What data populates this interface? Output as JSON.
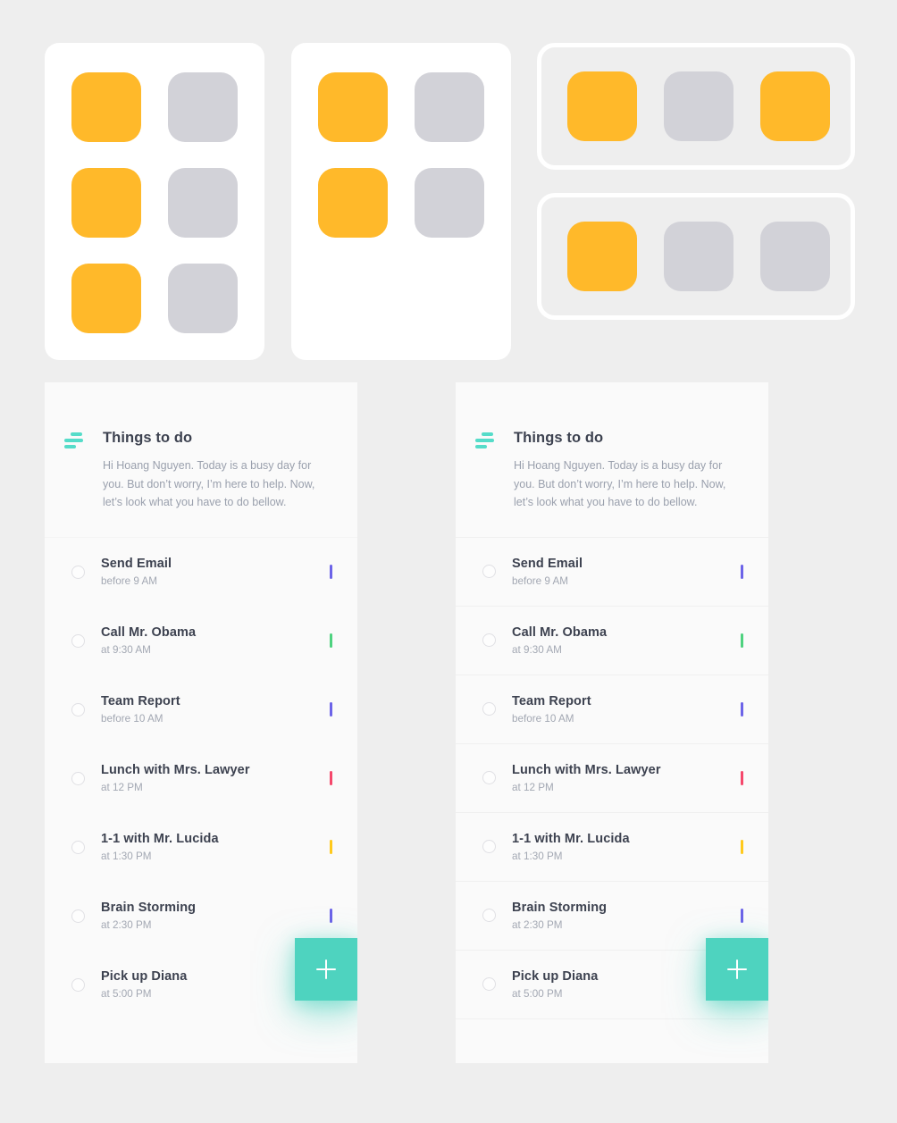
{
  "page": {
    "background_color": "#EEEEEE",
    "card_color": "#FFFFFF",
    "panel_color": "#FAFAFA",
    "accent_color": "#4ED3BF",
    "orange_tile_color": "#FFB92A",
    "grey_tile_color": "#D2D2D8"
  },
  "grid_cards": [
    {
      "name": "grid-card-three-rows",
      "style": "filled",
      "columns": 2,
      "rows": 3,
      "tiles": [
        "orange",
        "grey",
        "orange",
        "grey",
        "orange",
        "grey"
      ]
    },
    {
      "name": "grid-card-two-rows",
      "style": "filled",
      "columns": 2,
      "rows": 2,
      "tiles": [
        "orange",
        "grey",
        "orange",
        "grey"
      ]
    },
    {
      "name": "outline-card-top",
      "style": "outlined",
      "columns": 3,
      "rows": 1,
      "tiles": [
        "orange",
        "grey",
        "orange"
      ]
    },
    {
      "name": "outline-card-bottom",
      "style": "outlined",
      "columns": 3,
      "rows": 1,
      "tiles": [
        "orange",
        "grey",
        "grey"
      ]
    }
  ],
  "panels": [
    {
      "variant": "no-dividers",
      "header": {
        "icon": "sort-lines-icon",
        "title": "Things to do",
        "description": "Hi Hoang Nguyen. Today is a busy day for you. But don’t worry, I’m here to help. Now, let’s look what you have to do bellow."
      },
      "fab": {
        "icon": "plus-icon",
        "label": "+"
      },
      "tasks": [
        {
          "title": "Send Email",
          "time": "before 9 AM",
          "tag_color": "#6C63E8",
          "checked": false
        },
        {
          "title": "Call Mr. Obama",
          "time": "at 9:30 AM",
          "tag_color": "#4ED27F",
          "checked": false
        },
        {
          "title": "Team Report",
          "time": "before 10 AM",
          "tag_color": "#6C63E8",
          "checked": false
        },
        {
          "title": "Lunch with Mrs. Lawyer",
          "time": "at 12 PM",
          "tag_color": "#F5476B",
          "checked": false
        },
        {
          "title": "1-1 with Mr. Lucida",
          "time": "at 1:30 PM",
          "tag_color": "#FFC91C",
          "checked": false
        },
        {
          "title": "Brain Storming",
          "time": "at 2:30 PM",
          "tag_color": "#6C63E8",
          "checked": false
        },
        {
          "title": "Pick up Diana",
          "time": "at 5:00 PM",
          "tag_color": "#6C63E8",
          "checked": false
        }
      ]
    },
    {
      "variant": "with-dividers",
      "header": {
        "icon": "sort-lines-icon",
        "title": "Things to do",
        "description": "Hi Hoang Nguyen. Today is a busy day for you. But don’t worry, I’m here to help. Now, let’s look what you have to do bellow."
      },
      "fab": {
        "icon": "plus-icon",
        "label": "+"
      },
      "tasks": [
        {
          "title": "Send Email",
          "time": "before 9 AM",
          "tag_color": "#6C63E8",
          "checked": false
        },
        {
          "title": "Call Mr. Obama",
          "time": "at 9:30 AM",
          "tag_color": "#4ED27F",
          "checked": false
        },
        {
          "title": "Team Report",
          "time": "before 10 AM",
          "tag_color": "#6C63E8",
          "checked": false
        },
        {
          "title": "Lunch with Mrs. Lawyer",
          "time": "at 12 PM",
          "tag_color": "#F5476B",
          "checked": false
        },
        {
          "title": "1-1 with Mr. Lucida",
          "time": "at 1:30 PM",
          "tag_color": "#FFC91C",
          "checked": false
        },
        {
          "title": "Brain Storming",
          "time": "at 2:30 PM",
          "tag_color": "#6C63E8",
          "checked": false
        },
        {
          "title": "Pick up Diana",
          "time": "at 5:00 PM",
          "tag_color": "#6C63E8",
          "checked": false
        }
      ]
    }
  ]
}
